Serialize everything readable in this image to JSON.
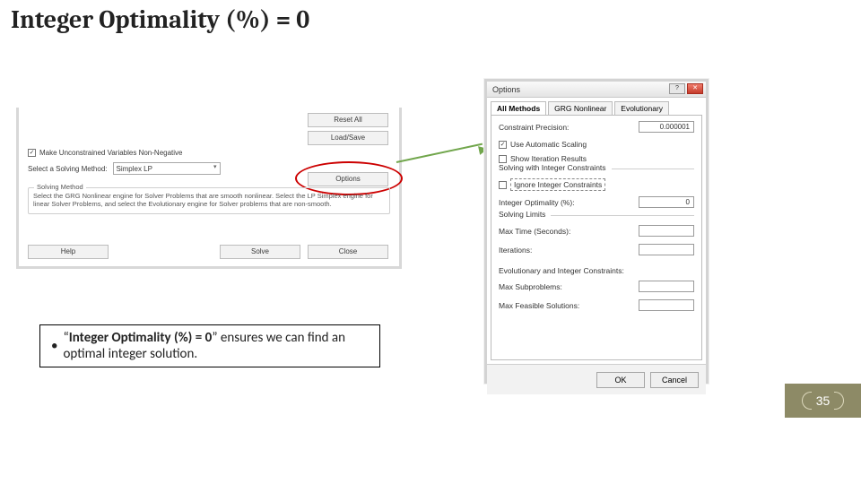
{
  "title": "Integer Optimality (%) = 0",
  "solver": {
    "reset_all": "Reset All",
    "load_save": "Load/Save",
    "nonneg": "Make Unconstrained Variables Non-Negative",
    "method_label": "Select a Solving Method:",
    "method_value": "Simplex LP",
    "options_btn": "Options",
    "method_box_title": "Solving Method",
    "method_desc": "Select the GRG Nonlinear engine for Solver Problems that are smooth nonlinear. Select the LP Simplex engine for linear Solver Problems, and select the Evolutionary engine for Solver problems that are non-smooth.",
    "help": "Help",
    "solve": "Solve",
    "close": "Close"
  },
  "callout": {
    "bullet": "•",
    "text_pre": "“",
    "text_bold": "Integer Optimality (%) = 0",
    "text_post": "” ensures we can find an optimal integer solution."
  },
  "options": {
    "title": "Options",
    "help_btn": "?",
    "close_btn": "✕",
    "tabs": {
      "all": "All Methods",
      "grg": "GRG Nonlinear",
      "evo": "Evolutionary"
    },
    "precision_label": "Constraint Precision:",
    "precision_value": "0.000001",
    "auto_scale": "Use Automatic Scaling",
    "show_iter": "Show Iteration Results",
    "grp_int": "Solving with Integer Constraints",
    "ignore_int": "Ignore Integer Constraints",
    "int_opt_label": "Integer Optimality (%):",
    "int_opt_value": "0",
    "grp_lim": "Solving Limits",
    "max_time": "Max Time (Seconds):",
    "iterations": "Iterations:",
    "grp_evo": "Evolutionary and Integer Constraints:",
    "max_sub": "Max Subproblems:",
    "max_feas": "Max Feasible Solutions:",
    "ok": "OK",
    "cancel": "Cancel"
  },
  "slide_number": "35"
}
